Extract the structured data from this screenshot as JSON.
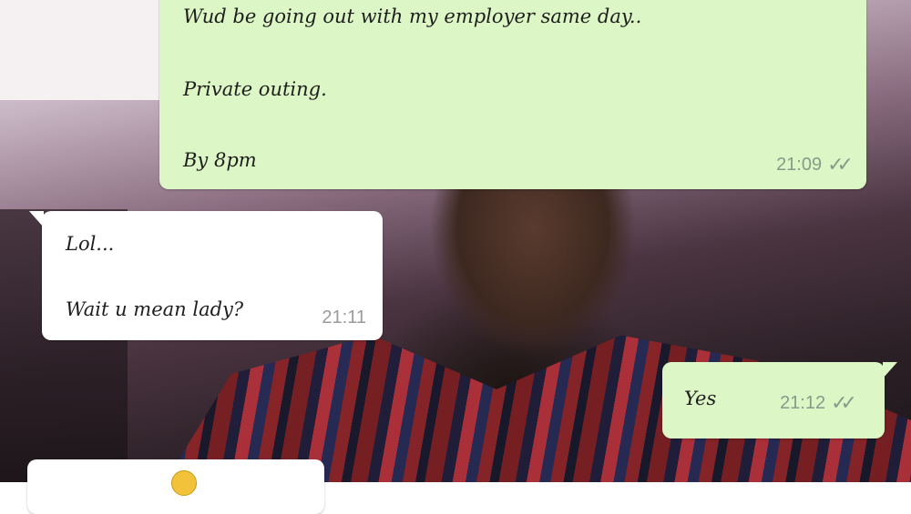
{
  "messages": [
    {
      "direction": "outgoing",
      "lines": [
        "Wud be going out with my employer same day..",
        "Private outing.",
        "By 8pm"
      ],
      "time": "21:09",
      "status_icon": "double-check-icon"
    },
    {
      "direction": "incoming",
      "lines": [
        "Lol...",
        "Wait u mean lady?"
      ],
      "time": "21:11"
    },
    {
      "direction": "outgoing",
      "lines": [
        "Yes"
      ],
      "time": "21:12",
      "status_icon": "double-check-icon"
    },
    {
      "direction": "incoming",
      "lines": [],
      "emoji_icon": "face-emoji-icon",
      "partial": true
    }
  ],
  "colors": {
    "outgoing_bubble": "#dcf7c5",
    "incoming_bubble": "#ffffff",
    "meta_text": "#8a9a8a"
  },
  "glyphs": {
    "double_check": "✓✓"
  }
}
